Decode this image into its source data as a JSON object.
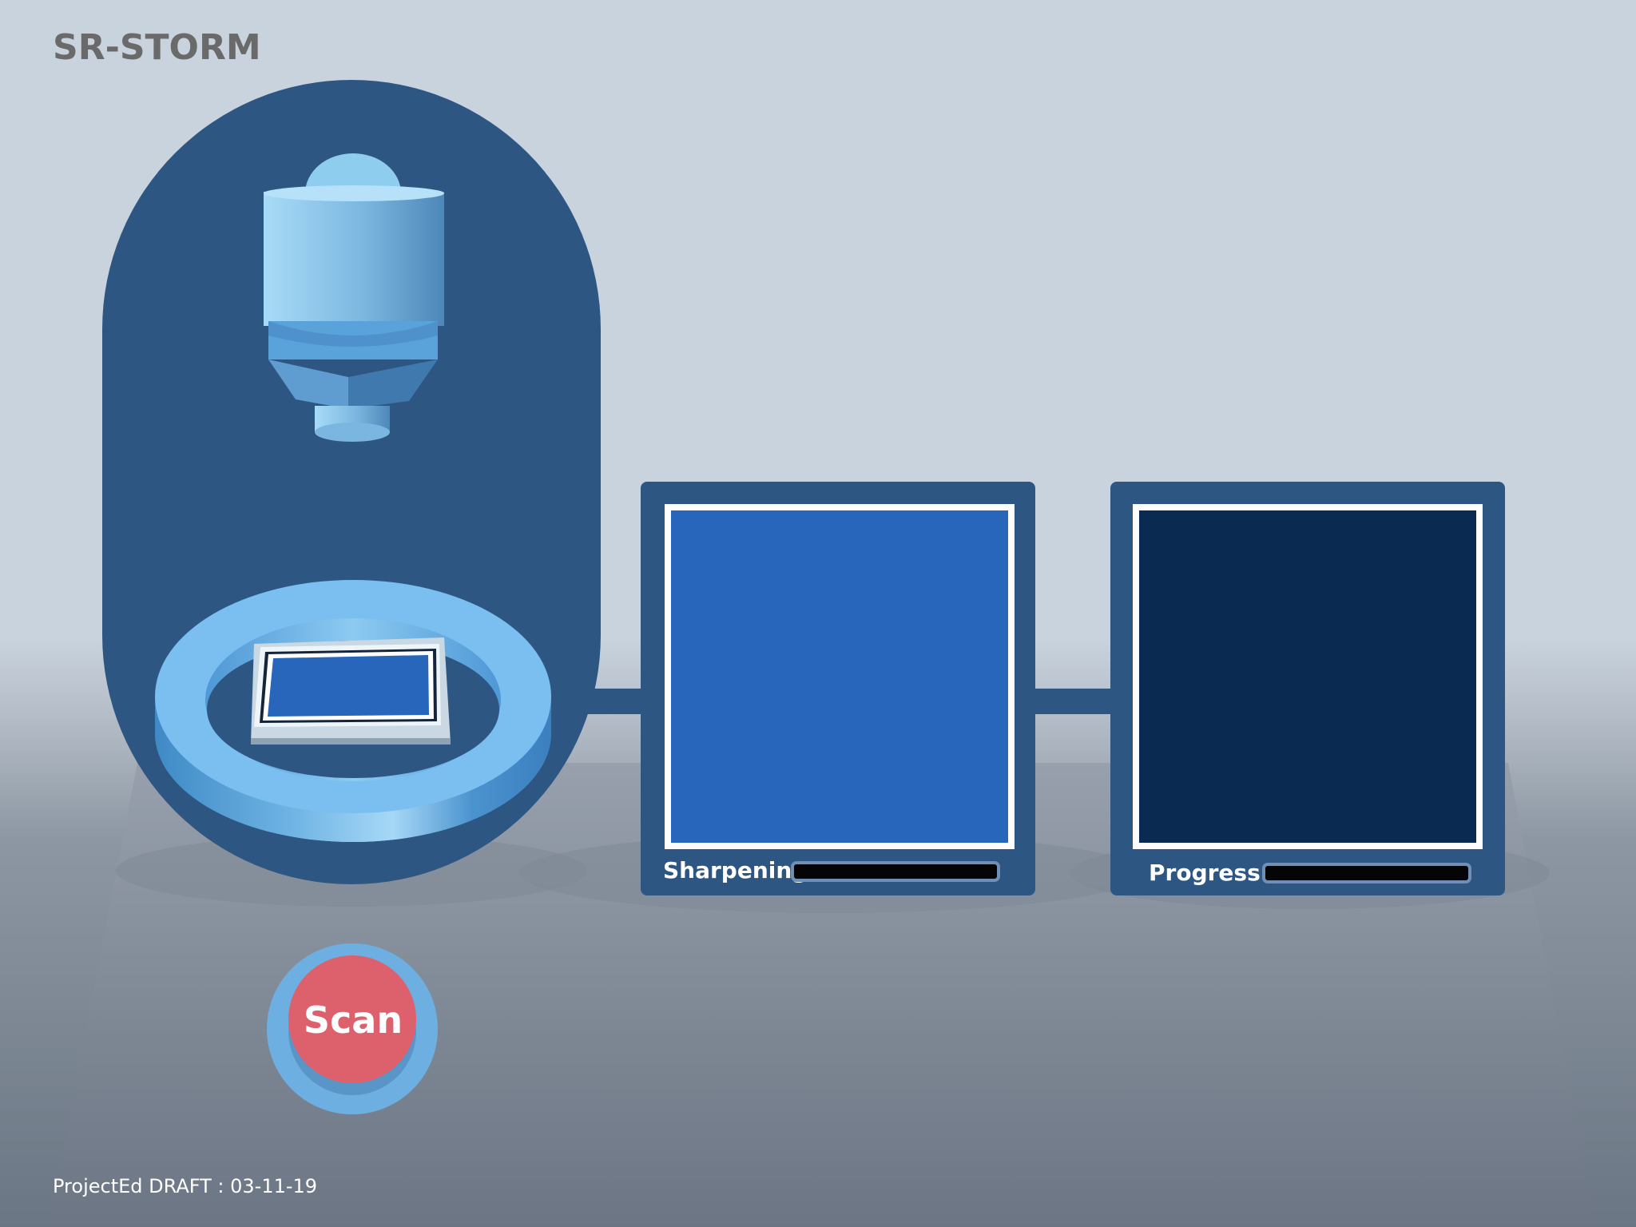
{
  "app": {
    "title": "SR-STORM",
    "footer": "ProjectEd DRAFT : 03-11-19"
  },
  "panels": {
    "sharpening": {
      "label": "Sharpening",
      "progress": 0,
      "screen_color": "#2766bb"
    },
    "progress": {
      "label": "Progress",
      "progress": 0,
      "screen_color": "#0b2a52"
    }
  },
  "scan_button": {
    "label": "Scan",
    "color": "#dd616c"
  },
  "colors": {
    "housing": "#2e5683",
    "accent_light": "#7cc0ef",
    "platform_top": "#98a1ad"
  }
}
